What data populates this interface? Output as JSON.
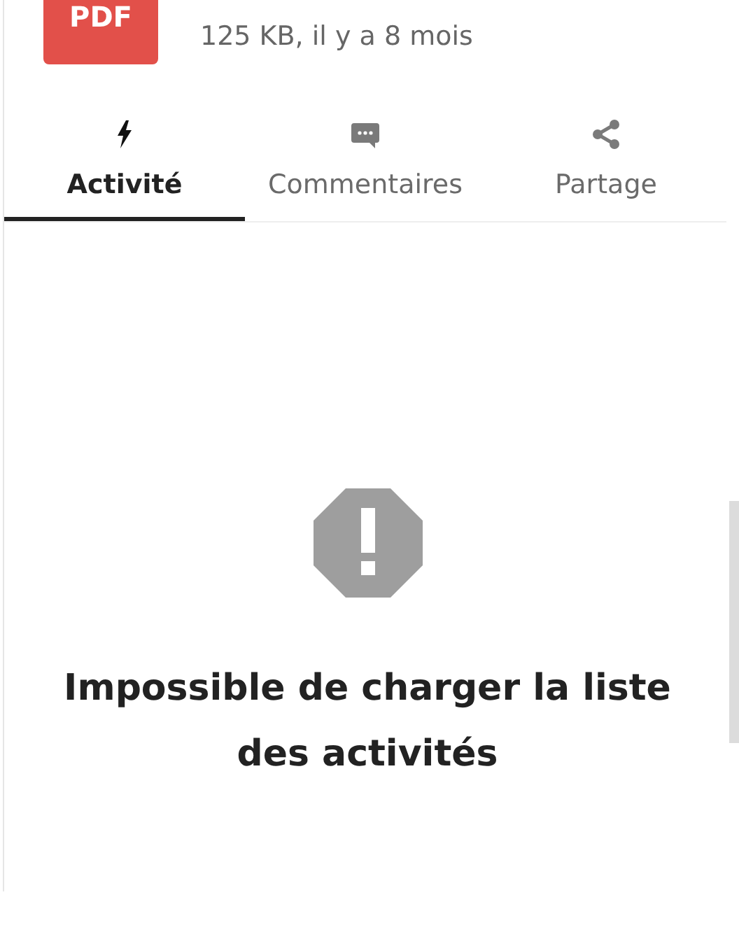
{
  "file": {
    "type_label": "PDF",
    "meta": "125 KB, il y a 8 mois"
  },
  "tabs": [
    {
      "label": "Activité",
      "kind": "activity",
      "selected": true
    },
    {
      "label": "Commentaires",
      "kind": "comments",
      "selected": false
    },
    {
      "label": "Partage",
      "kind": "sharing",
      "selected": false
    }
  ],
  "empty_state": {
    "message": "Impossible de charger la liste des activités"
  }
}
